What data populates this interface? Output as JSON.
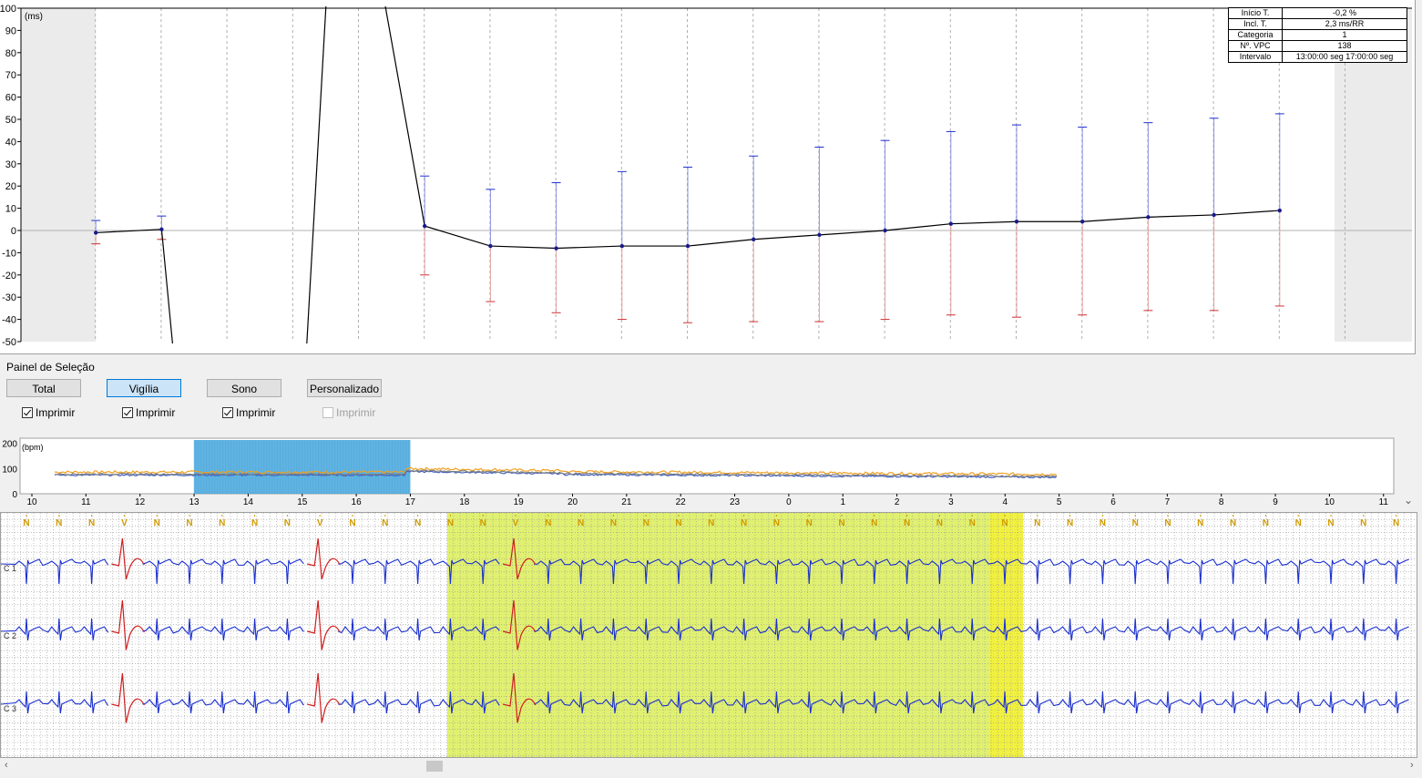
{
  "top_chart": {
    "unit_label": "(ms)",
    "y_ticks": [
      "100",
      "90",
      "80",
      "70",
      "60",
      "50",
      "40",
      "30",
      "20",
      "10",
      "0",
      "-10",
      "-20",
      "-30",
      "-40",
      "-50"
    ],
    "ylim": [
      -50,
      100
    ],
    "stats": [
      {
        "label": "Início T.",
        "value": "-0,2 %"
      },
      {
        "label": "Incl. T.",
        "value": "2,3 ms/RR"
      },
      {
        "label": "Categoria",
        "value": "1"
      },
      {
        "label": "Nº. VPC",
        "value": "138"
      },
      {
        "label": "Intervalo",
        "value": "13:00:00 seg 17:00:00 seg"
      }
    ],
    "colors": {
      "line": "#000000",
      "point": "#1a1a8c",
      "upper": "#2030d0",
      "lower": "#d03030"
    }
  },
  "chart_data": {
    "type": "line",
    "ylabel": "(ms)",
    "ylim": [
      -50,
      100
    ],
    "points": [
      {
        "i": 1,
        "y": -1,
        "hi": 4.5,
        "lo": -6
      },
      {
        "i": 2,
        "y": 0.5,
        "hi": 6.5,
        "lo": -4
      },
      {
        "i": 6,
        "y": 2,
        "hi": 24.5,
        "lo": -20
      },
      {
        "i": 7,
        "y": -7,
        "hi": 18.5,
        "lo": -32
      },
      {
        "i": 8,
        "y": -8,
        "hi": 21.5,
        "lo": -37
      },
      {
        "i": 9,
        "y": -7,
        "hi": 26.5,
        "lo": -40
      },
      {
        "i": 10,
        "y": -7,
        "hi": 28.5,
        "lo": -41.5
      },
      {
        "i": 11,
        "y": -4,
        "hi": 33.5,
        "lo": -41
      },
      {
        "i": 12,
        "y": -2,
        "hi": 37.5,
        "lo": -41
      },
      {
        "i": 13,
        "y": 0,
        "hi": 40.5,
        "lo": -40
      },
      {
        "i": 14,
        "y": 3,
        "hi": 44.5,
        "lo": -38
      },
      {
        "i": 15,
        "y": 4,
        "hi": 47.5,
        "lo": -39
      },
      {
        "i": 16,
        "y": 4,
        "hi": 46.5,
        "lo": -38
      },
      {
        "i": 17,
        "y": 6,
        "hi": 48.5,
        "lo": -36
      },
      {
        "i": 18,
        "y": 7,
        "hi": 50.5,
        "lo": -36
      },
      {
        "i": 19,
        "y": 9,
        "hi": 52.5,
        "lo": -34
      }
    ]
  },
  "selection_panel": {
    "title": "Painel de Seleção",
    "buttons": [
      "Total",
      "Vigília",
      "Sono",
      "Personalizado"
    ],
    "active": "Vigília",
    "print_label": "Imprimir",
    "print_checked": [
      true,
      true,
      true,
      false
    ]
  },
  "trend": {
    "unit_label": "(bpm)",
    "y_ticks": [
      "200",
      "100",
      "0"
    ],
    "x_ticks": [
      "10",
      "11",
      "12",
      "13",
      "14",
      "15",
      "16",
      "17",
      "18",
      "19",
      "20",
      "21",
      "22",
      "23",
      "0",
      "1",
      "2",
      "3",
      "4",
      "5",
      "6",
      "7",
      "8",
      "9",
      "10",
      "11"
    ],
    "selection": [
      "13",
      "17"
    ],
    "selection_color": "#3ca0d8",
    "colors": {
      "hr_max": "#f0a020",
      "hr_mean": "#808080",
      "hr_min": "#4060c0"
    }
  },
  "ecg": {
    "channels": [
      "C 1",
      "C 2",
      "C 3"
    ],
    "beat_labels": [
      "N",
      "N",
      "N",
      "V",
      "N",
      "N",
      "N",
      "N",
      "N",
      "V",
      "N",
      "N",
      "N",
      "N",
      "N",
      "V",
      "N",
      "N",
      "N",
      "N",
      "N",
      "N",
      "N",
      "N",
      "N",
      "N",
      "N",
      "N",
      "N",
      "N",
      "N",
      "N",
      "N",
      "N",
      "N",
      "N",
      "N",
      "N",
      "N",
      "N",
      "N",
      "N",
      "N"
    ],
    "colors": {
      "normal": "#1a2fd0",
      "ectopic": "#d02020",
      "highlight": "#e0f070",
      "selected": "#f0f040",
      "grid": "#999999",
      "label": "#d09a00"
    }
  }
}
